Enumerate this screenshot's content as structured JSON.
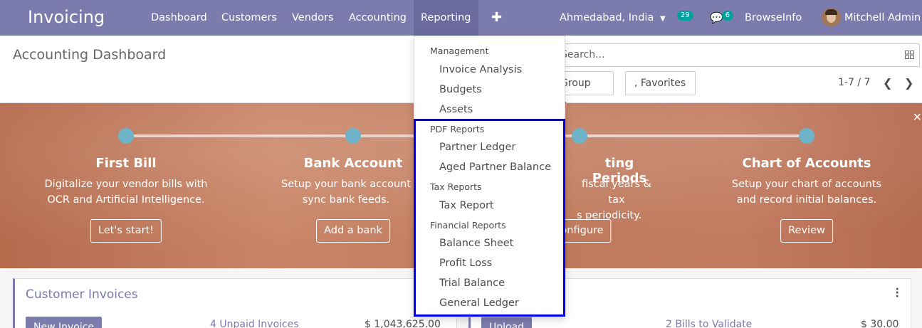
{
  "navbar": {
    "brand": "Invoicing",
    "menu": [
      "Dashboard",
      "Customers",
      "Vendors",
      "Accounting",
      "Reporting"
    ],
    "plus_icon": "plus-icon",
    "company": "Ahmedabad, India",
    "activity_count": "29",
    "messages_count": "6",
    "browse": "BrowseInfo",
    "user": "Mitchell Admin",
    "accent": "#7c7bad"
  },
  "control_panel": {
    "title": "Accounting Dashboard",
    "search_placeholder": "Search...",
    "group_by": "Group By",
    "favorites": "Favorites",
    "pager": "1-7 / 7"
  },
  "banner": {
    "steps": [
      {
        "title": "First Bill",
        "desc1": "Digitalize your vendor bills with",
        "desc2": "OCR and Artificial Intelligence.",
        "button": "Let's start!"
      },
      {
        "title": "Bank Account",
        "desc1": "Setup your bank account",
        "desc2": "sync bank feeds.",
        "button": "Add a bank"
      },
      {
        "title": "ting Periods",
        "desc1": "fiscal years & tax",
        "desc2": "s periodicity.",
        "button": "onfigure"
      },
      {
        "title": "Chart of Accounts",
        "desc1": "Setup your chart of accounts",
        "desc2": "and record initial balances.",
        "button": "Review"
      }
    ]
  },
  "cards": {
    "left": {
      "title": "Customer Invoices",
      "button": "New Invoice",
      "link": "4 Unpaid Invoices",
      "amount": "$ 1,043,625.00"
    },
    "right": {
      "button": "Upload",
      "link": "2 Bills to Validate",
      "amount": "$ 30.00"
    }
  },
  "dropdown": {
    "sections": [
      {
        "header": "Management",
        "items": [
          "Invoice Analysis",
          "Budgets",
          "Assets"
        ]
      },
      {
        "header": "PDF Reports",
        "items": [
          "Partner Ledger",
          "Aged Partner Balance"
        ]
      },
      {
        "header": "Tax Reports",
        "items": [
          "Tax Report"
        ]
      },
      {
        "header": "Financial Reports",
        "items": [
          "Balance Sheet",
          "Profit Loss",
          "Trial Balance",
          "General Ledger"
        ]
      }
    ],
    "highlight_color": "#0000ee"
  }
}
